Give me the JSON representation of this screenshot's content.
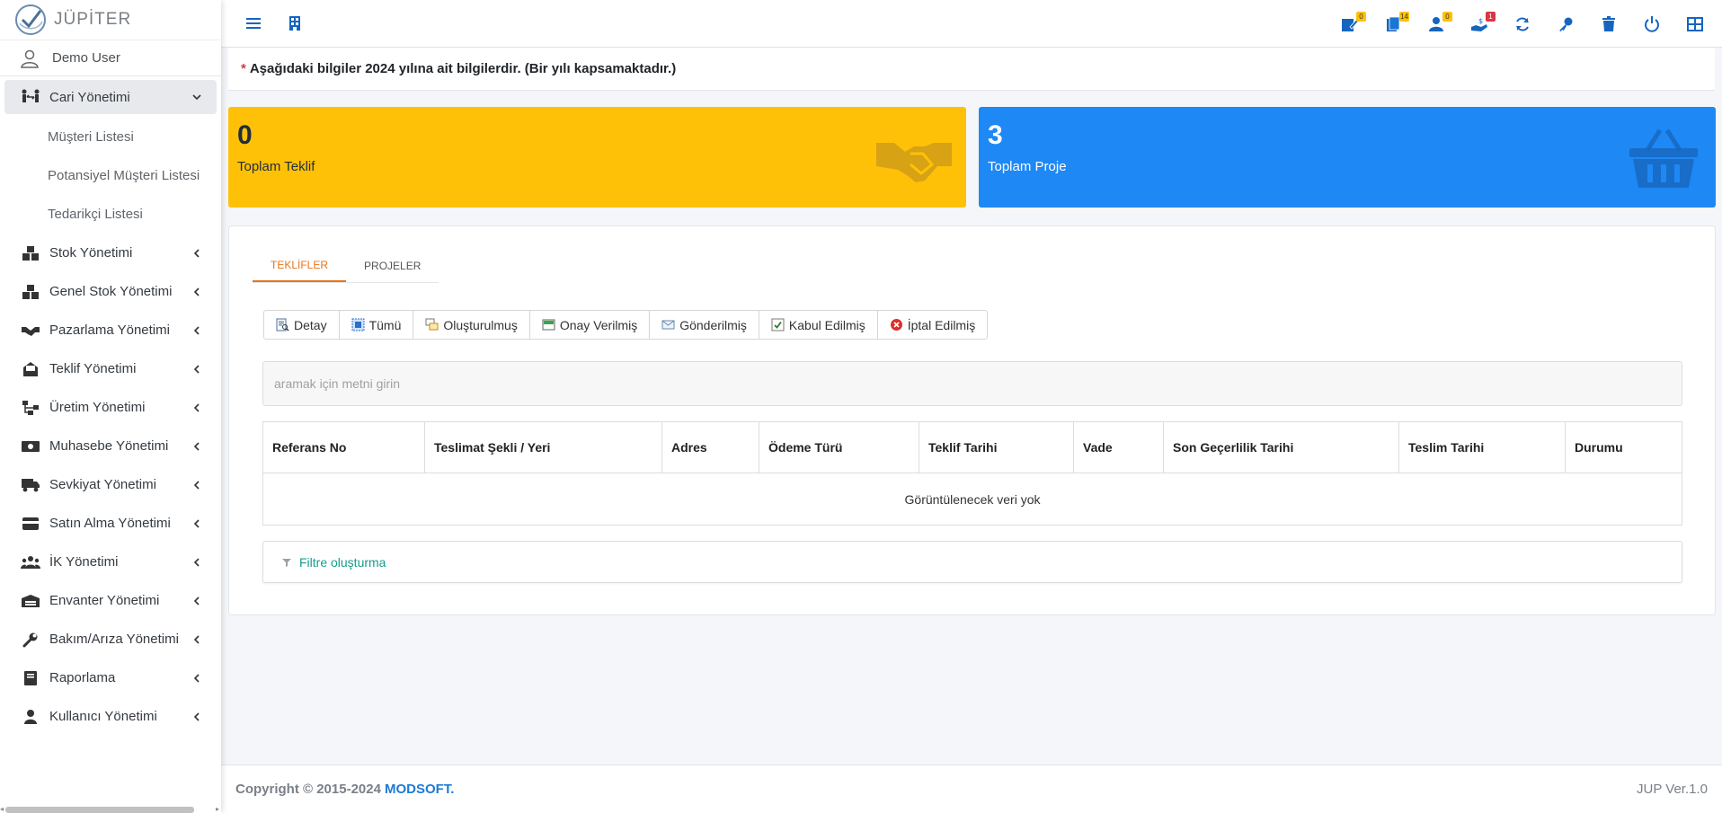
{
  "app": {
    "name": "JÜPİTER"
  },
  "user": {
    "name": "Demo User"
  },
  "sidebar": {
    "items": [
      {
        "label": "Cari Yönetimi",
        "icon": "people-arrows-icon",
        "expanded": true,
        "children": [
          {
            "label": "Müşteri Listesi"
          },
          {
            "label": "Potansiyel Müşteri Listesi"
          },
          {
            "label": "Tedarikçi Listesi"
          }
        ]
      },
      {
        "label": "Stok Yönetimi",
        "icon": "boxes-icon"
      },
      {
        "label": "Genel Stok Yönetimi",
        "icon": "boxes-icon"
      },
      {
        "label": "Pazarlama Yönetimi",
        "icon": "handshake-icon"
      },
      {
        "label": "Teklif Yönetimi",
        "icon": "envelope-open-icon"
      },
      {
        "label": "Üretim Yönetimi",
        "icon": "sitemap-icon"
      },
      {
        "label": "Muhasebe Yönetimi",
        "icon": "money-bill-icon"
      },
      {
        "label": "Sevkiyat Yönetimi",
        "icon": "truck-icon"
      },
      {
        "label": "Satın Alma Yönetimi",
        "icon": "credit-card-icon"
      },
      {
        "label": "İK Yönetimi",
        "icon": "users-icon"
      },
      {
        "label": "Envanter Yönetimi",
        "icon": "warehouse-icon"
      },
      {
        "label": "Bakım/Arıza Yönetimi",
        "icon": "wrench-icon"
      },
      {
        "label": "Raporlama",
        "icon": "book-icon"
      },
      {
        "label": "Kullanıcı Yönetimi",
        "icon": "user-icon"
      }
    ]
  },
  "topbar": {
    "badges": {
      "tasks": "0",
      "docs": "14",
      "approvals": "0",
      "payments": "1"
    }
  },
  "notice": {
    "star": "*",
    "text": "Aşağıdaki bilgiler 2024 yılına ait bilgilerdir. (Bir yılı kapsamaktadır.)"
  },
  "stats": {
    "offers": {
      "value": "0",
      "label": "Toplam Teklif",
      "color": "#ffc107"
    },
    "projects": {
      "value": "3",
      "label": "Toplam Proje",
      "color": "#1e88f5"
    }
  },
  "tabs": [
    {
      "label": "TEKLİFLER"
    },
    {
      "label": "PROJELER"
    }
  ],
  "filter_buttons": [
    {
      "label": "Detay"
    },
    {
      "label": "Tümü"
    },
    {
      "label": "Oluşturulmuş"
    },
    {
      "label": "Onay Verilmiş"
    },
    {
      "label": "Gönderilmiş"
    },
    {
      "label": "Kabul Edilmiş"
    },
    {
      "label": "İptal Edilmiş"
    }
  ],
  "search": {
    "placeholder": "aramak için metni girin"
  },
  "grid": {
    "columns": [
      "Referans No",
      "Teslimat Şekli / Yeri",
      "Adres",
      "Ödeme Türü",
      "Teklif Tarihi",
      "Vade",
      "Son Geçerlilik Tarihi",
      "Teslim Tarihi",
      "Durumu"
    ],
    "empty_text": "Görüntülenecek veri yok"
  },
  "filter_builder": {
    "label": "Filtre oluşturma"
  },
  "footer": {
    "copyright": "Copyright © 2015-2024",
    "brand": "MODSOFT.",
    "version": "JUP Ver.1.0"
  }
}
